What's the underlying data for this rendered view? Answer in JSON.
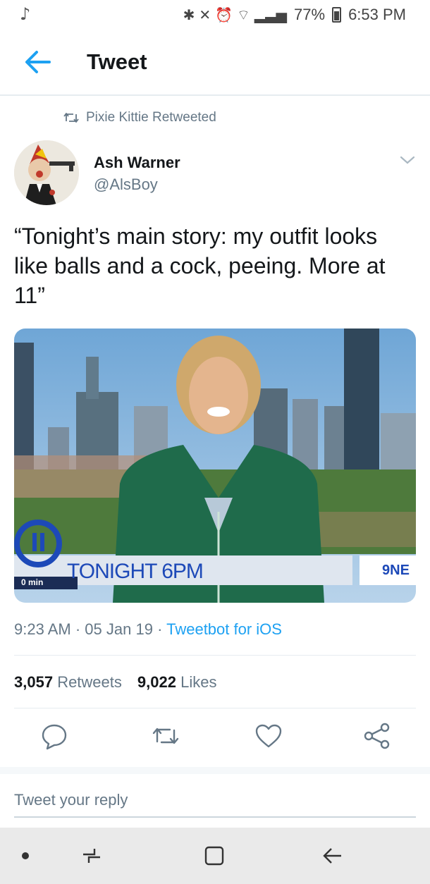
{
  "status_bar": {
    "left_icon": "music-note-icon",
    "battery": "77%",
    "time": "6:53 PM"
  },
  "header": {
    "title": "Tweet",
    "back_icon": "arrow-left-icon"
  },
  "retweet_context": {
    "text": "Pixie Kittie Retweeted"
  },
  "tweet": {
    "author_name": "Ash Warner",
    "author_handle": "@AlsBoy",
    "text": "“Tonight’s main story: my outfit looks like balls and a cock, peeing. More at 11”",
    "media": {
      "banner_text": "TONIGHT 6PM",
      "channel_text": "9NE",
      "clock_text": "0 min"
    },
    "time": "9:23 AM",
    "date": "05 Jan 19",
    "source": "Tweetbot for iOS",
    "retweets_count": "3,057",
    "retweets_label": "Retweets",
    "likes_count": "9,022",
    "likes_label": "Likes"
  },
  "actions": [
    "reply-icon",
    "retweet-icon",
    "like-icon",
    "share-icon"
  ],
  "reply": {
    "placeholder": "Tweet your reply"
  },
  "colors": {
    "accent": "#1da1f2",
    "text": "#14171a",
    "secondary": "#657786"
  }
}
